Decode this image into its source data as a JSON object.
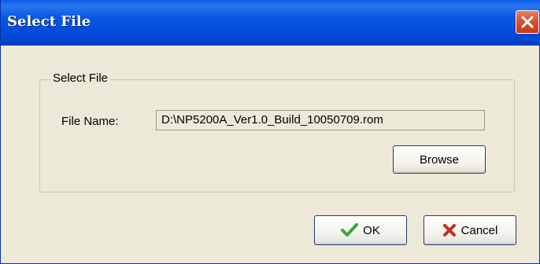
{
  "window": {
    "title": "Select File",
    "close_icon": "close-icon"
  },
  "group": {
    "legend": "Select File",
    "file_name_label": "File Name:",
    "file_name_value": "D:\\NP5200A_Ver1.0_Build_10050709.rom",
    "browse_label": "Browse"
  },
  "buttons": {
    "ok_label": "OK",
    "ok_icon": "checkmark-icon",
    "cancel_label": "Cancel",
    "cancel_icon": "x-mark-icon"
  },
  "colors": {
    "title_bar": "#0656e0",
    "dialog_bg": "#ece9d8",
    "close_red": "#d8522f",
    "ok_green": "#3aa63a",
    "cancel_red": "#c0301c"
  }
}
